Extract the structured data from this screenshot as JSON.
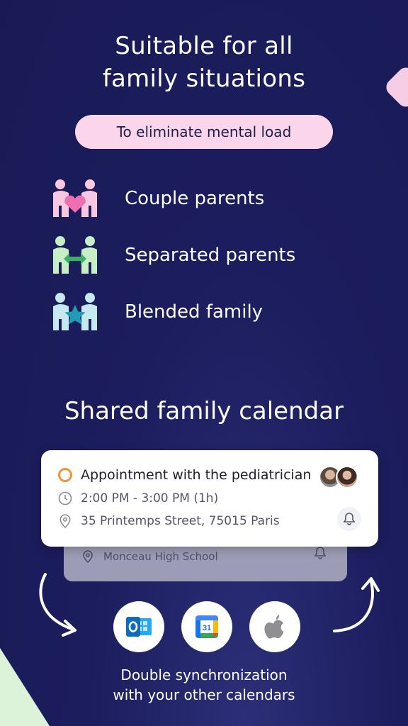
{
  "headline": {
    "line1": "Suitable for all",
    "line2": "family situations"
  },
  "pill": "To eliminate mental load",
  "situations": [
    {
      "icon": "couple-parents-icon",
      "label": "Couple parents",
      "color": "#f8c8e0",
      "accent": "#f06fb1"
    },
    {
      "icon": "separated-parents-icon",
      "label": "Separated parents",
      "color": "#c6efc6",
      "accent": "#3fae6a"
    },
    {
      "icon": "blended-family-icon",
      "label": "Blended family",
      "color": "#c5e9ef",
      "accent": "#1e9cb3"
    }
  ],
  "section_title": "Shared family calendar",
  "event_card": {
    "title": "Appointment with the pediatrician",
    "time": "2:00 PM - 3:00 PM (1h)",
    "address": "35 Printemps Street, 75015 Paris"
  },
  "back_card": {
    "location": "Monceau High School"
  },
  "sync": {
    "apps": [
      "outlook-icon",
      "google-calendar-icon",
      "apple-icon"
    ],
    "google_day": "31",
    "caption_line1": "Double synchronization",
    "caption_line2": "with your other calendars"
  },
  "colors": {
    "background": "#1c1d5e",
    "pill": "#fbd6ea",
    "event_ring": "#f0953c"
  }
}
